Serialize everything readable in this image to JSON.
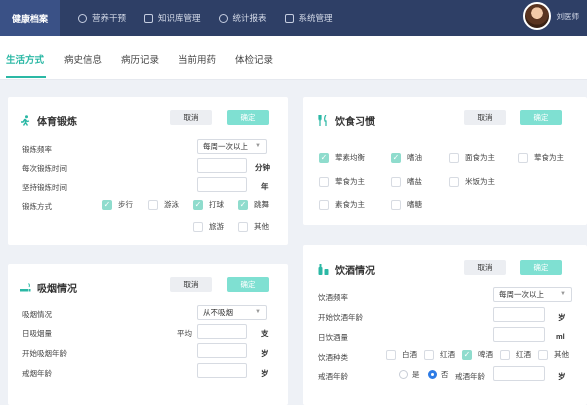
{
  "nav": {
    "brand": "健康档案",
    "items": [
      "营养干预",
      "知识库管理",
      "统计报表",
      "系统管理"
    ],
    "user": "刘医师"
  },
  "tabs": [
    "生活方式",
    "病史信息",
    "病历记录",
    "当前用药",
    "体检记录"
  ],
  "buttons": {
    "cancel": "取消",
    "confirm": "确定"
  },
  "exercise": {
    "title": "体育锻炼",
    "freq_label": "锻炼频率",
    "freq_value": "每周一次以上",
    "time_label": "每次锻炼时间",
    "time_unit": "分钟",
    "years_label": "坚持锻炼时间",
    "years_unit": "年",
    "mode_label": "锻炼方式",
    "modes": [
      {
        "label": "步行",
        "checked": true
      },
      {
        "label": "游泳",
        "checked": false
      },
      {
        "label": "打球",
        "checked": true
      },
      {
        "label": "跳舞",
        "checked": true
      },
      {
        "label": "旅游",
        "checked": false
      },
      {
        "label": "其他",
        "checked": false
      }
    ]
  },
  "diet": {
    "title": "饮食习惯",
    "items": [
      {
        "label": "荤素均衡",
        "checked": true
      },
      {
        "label": "嗜油",
        "checked": true
      },
      {
        "label": "面食为主",
        "checked": false
      },
      {
        "label": "荤食为主",
        "checked": false
      },
      {
        "label": "荤食为主",
        "checked": false
      },
      {
        "label": "嗜盐",
        "checked": false
      },
      {
        "label": "米饭为主",
        "checked": false
      },
      {
        "label": "素食为主",
        "checked": false
      },
      {
        "label": "嗜糖",
        "checked": false
      }
    ]
  },
  "smoking": {
    "title": "吸烟情况",
    "status_label": "吸烟情况",
    "status_value": "从不吸烟",
    "daily_label": "日吸烟量",
    "daily_prefix": "平均",
    "daily_unit": "支",
    "start_label": "开始吸烟年龄",
    "start_unit": "岁",
    "quit_label": "戒烟年龄",
    "quit_unit": "岁"
  },
  "drinking": {
    "title": "饮酒情况",
    "freq_label": "饮酒频率",
    "freq_value": "每周一次以上",
    "start_label": "开始饮酒年龄",
    "start_unit": "岁",
    "daily_label": "日饮酒量",
    "daily_unit": "ml",
    "type_label": "饮酒种类",
    "types": [
      {
        "label": "白酒",
        "checked": false
      },
      {
        "label": "红酒",
        "checked": false
      },
      {
        "label": "啤酒",
        "checked": true
      },
      {
        "label": "红酒",
        "checked": false
      },
      {
        "label": "其他",
        "checked": false
      }
    ],
    "quit_label": "戒酒年龄",
    "quit_no": "是",
    "quit_yes": "否",
    "quit_age_label": "戒酒年龄",
    "quit_unit": "岁"
  },
  "colors": {
    "accent": "#2bb8a5",
    "nav_bg": "#2e3f66",
    "check_on": "#8fdccd",
    "confirm_btn": "#7fe0d2"
  }
}
